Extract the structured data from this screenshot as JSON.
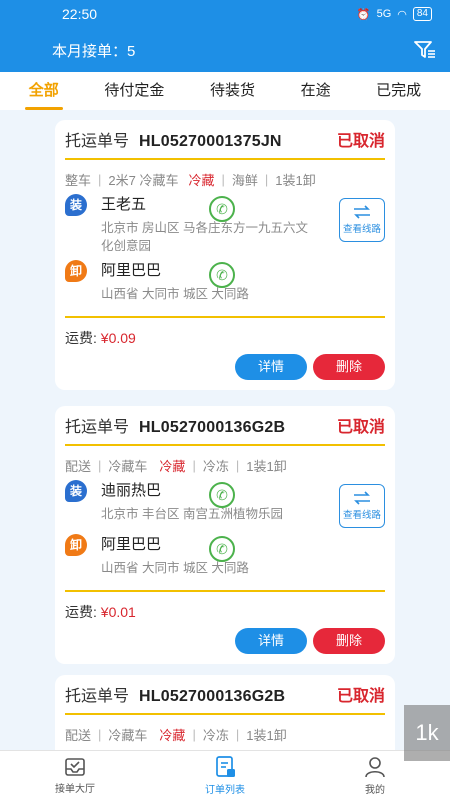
{
  "status_bar": {
    "time": "22:50",
    "battery": "84",
    "signal": "5G"
  },
  "header": {
    "month_orders": "本月接单：5"
  },
  "tabs": [
    {
      "label": "全部",
      "active": true
    },
    {
      "label": "待付定金",
      "active": false
    },
    {
      "label": "待装货",
      "active": false
    },
    {
      "label": "在途",
      "active": false
    },
    {
      "label": "已完成",
      "active": false
    }
  ],
  "labels": {
    "order_no": "托运单号",
    "fee": "运费:",
    "view_route": "查看线路",
    "details": "详情",
    "delete": "删除",
    "load_tag": "装",
    "unload_tag": "卸"
  },
  "orders": [
    {
      "order_no": "HL05270001375JN",
      "status": "已取消",
      "meta": [
        "整车",
        "2米7 冷藏车",
        "冷藏",
        "海鲜",
        "1装1卸"
      ],
      "load": {
        "name": "王老五",
        "address": "北京市 房山区 马各庄东方一九五六文化创意园"
      },
      "unload": {
        "name": "阿里巴巴",
        "address": "山西省 大同市 城区 大同路"
      },
      "fee": "¥0.09"
    },
    {
      "order_no": "HL0527000136G2B",
      "status": "已取消",
      "meta": [
        "配送",
        "冷藏车",
        "冷藏",
        "冷冻",
        "1装1卸"
      ],
      "load": {
        "name": "迪丽热巴",
        "address": "北京市 丰台区 南宫五洲植物乐园"
      },
      "unload": {
        "name": "阿里巴巴",
        "address": "山西省 大同市 城区 大同路"
      },
      "fee": "¥0.01"
    },
    {
      "order_no": "HL0527000136G2B",
      "status": "已取消",
      "meta": [
        "配送",
        "冷藏车",
        "冷藏",
        "冷冻",
        "1装1卸"
      ]
    }
  ],
  "bottom_nav": [
    {
      "label": "接单大厅",
      "icon": "inbox-check-icon",
      "active": false
    },
    {
      "label": "订单列表",
      "icon": "order-list-icon",
      "active": true
    },
    {
      "label": "我的",
      "icon": "person-icon",
      "active": false
    }
  ],
  "watermark": "1k"
}
